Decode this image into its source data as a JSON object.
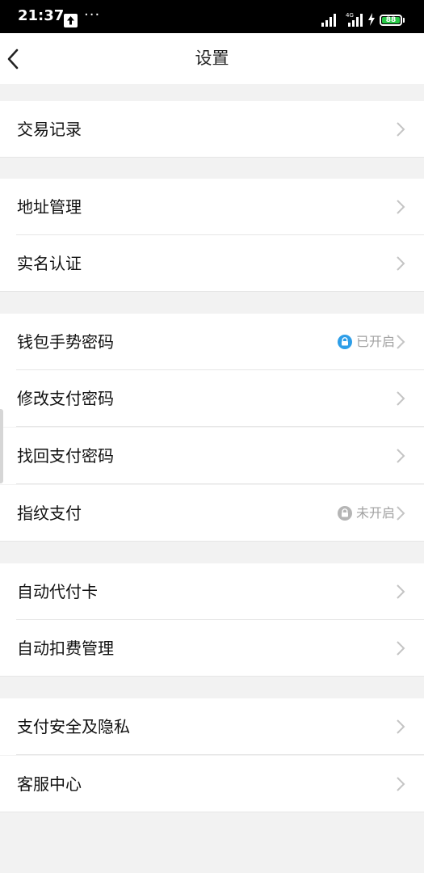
{
  "status_bar": {
    "time": "21:37",
    "dots": "···",
    "network": "4G",
    "battery": "88",
    "colors": {
      "battery": "#27c846"
    }
  },
  "nav": {
    "title": "设置",
    "back_icon": "chevron-left-icon"
  },
  "sections": [
    {
      "items": [
        {
          "label": "交易记录"
        }
      ]
    },
    {
      "items": [
        {
          "label": "地址管理"
        },
        {
          "label": "实名认证"
        }
      ]
    },
    {
      "items": [
        {
          "label": "钱包手势密码",
          "status": "已开启",
          "status_icon": "lock-icon",
          "status_color": "#2d9ee8"
        },
        {
          "label": "修改支付密码"
        },
        {
          "label": "找回支付密码"
        },
        {
          "label": "指纹支付",
          "status": "未开启",
          "status_icon": "lock-icon",
          "status_color": "#b5b5b5"
        }
      ]
    },
    {
      "items": [
        {
          "label": "自动代付卡"
        },
        {
          "label": "自动扣费管理"
        }
      ]
    },
    {
      "items": [
        {
          "label": "支付安全及隐私"
        },
        {
          "label": "客服中心"
        }
      ]
    }
  ],
  "colors": {
    "background": "#f2f2f2",
    "row_background": "#ffffff",
    "divider": "#e6e6e6",
    "chevron": "#c4c4c4",
    "status_text": "#a2a2a2"
  }
}
